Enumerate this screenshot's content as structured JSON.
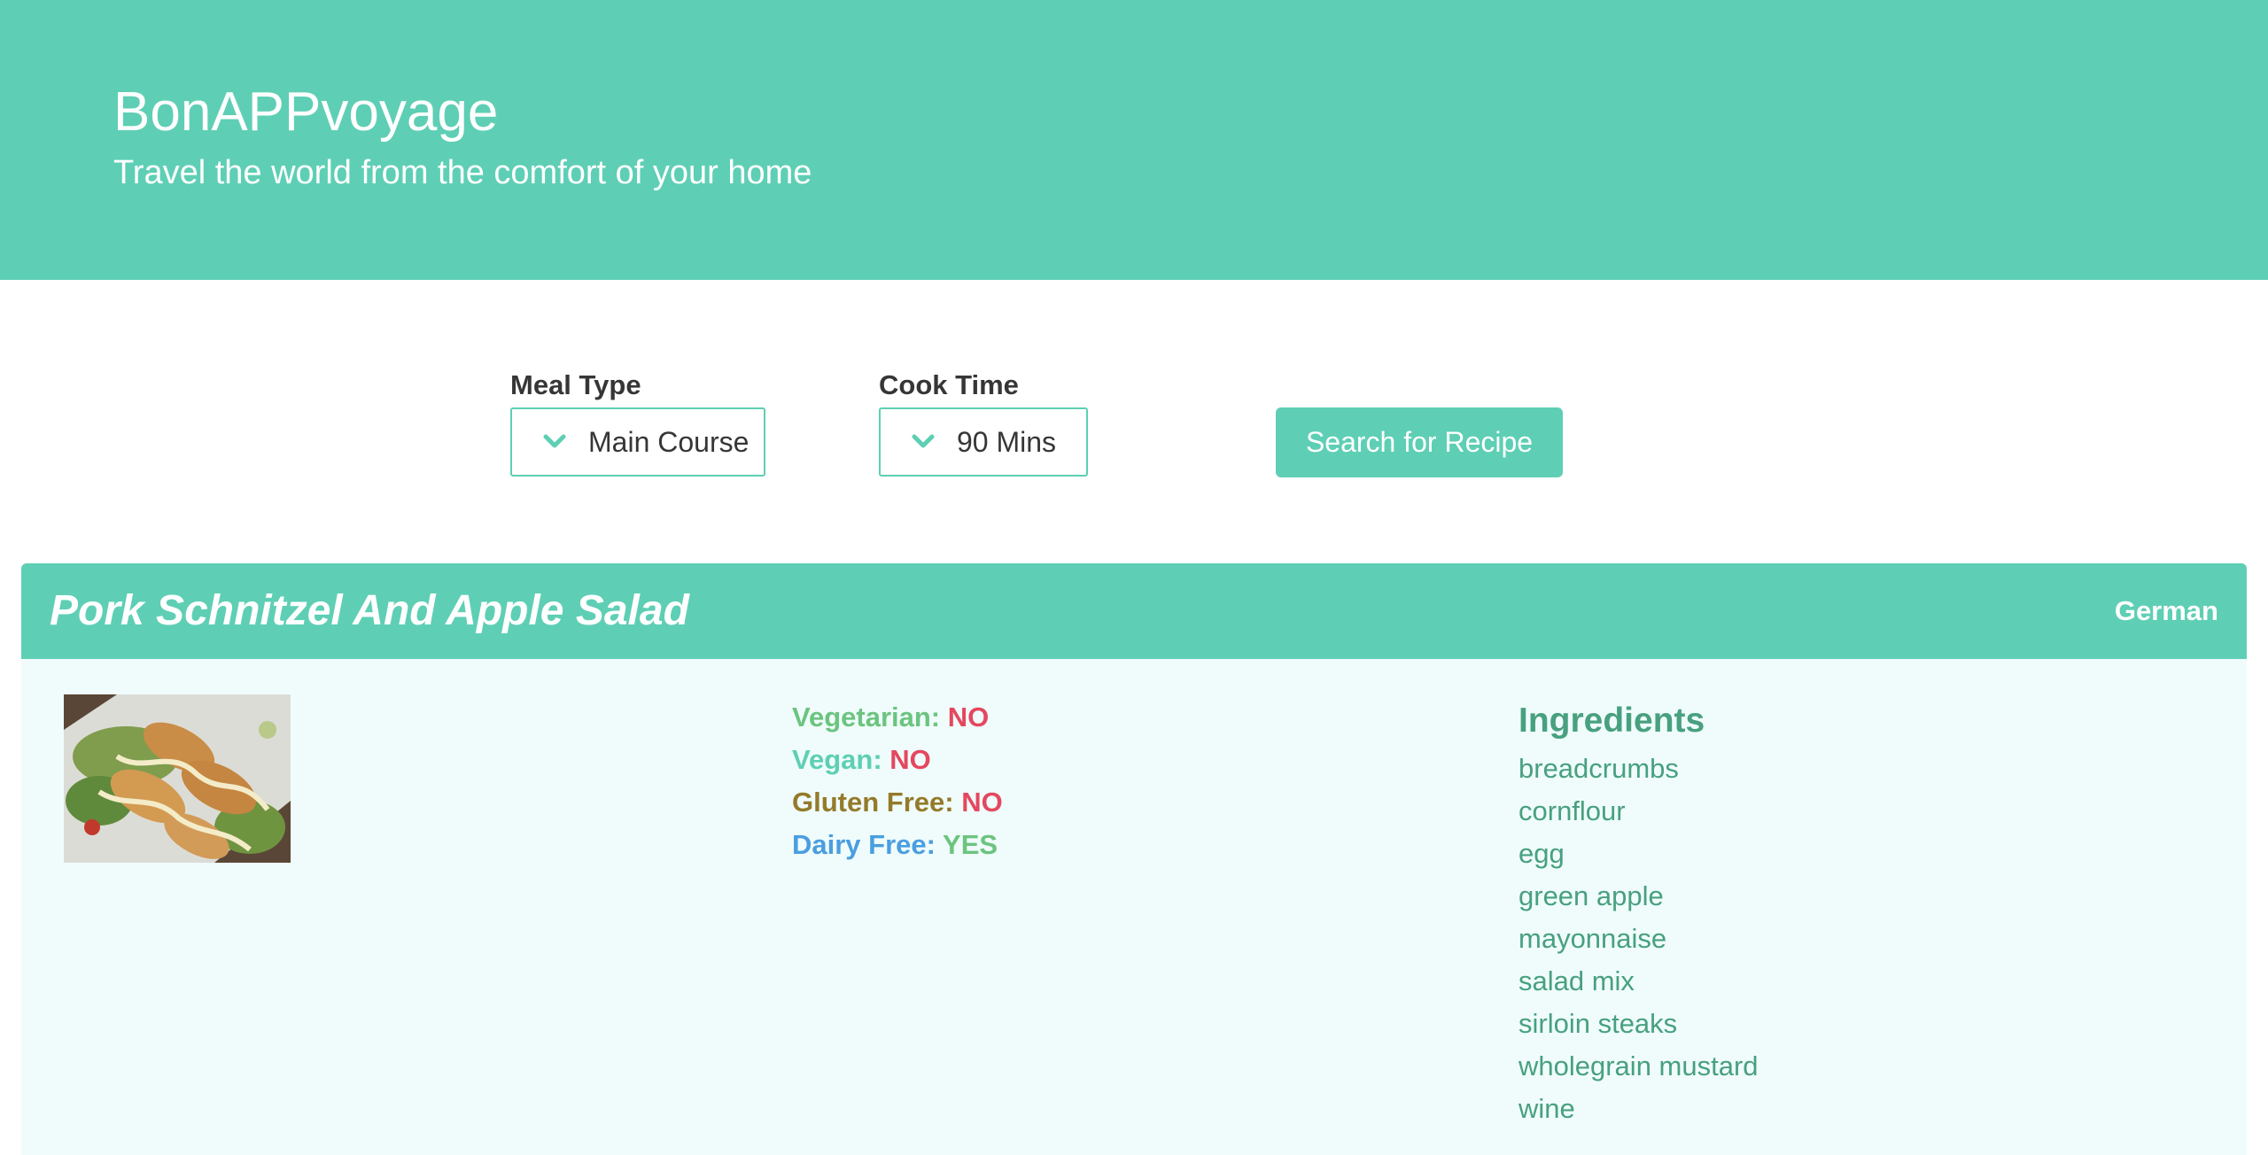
{
  "hero": {
    "title": "BonAPPvoyage",
    "subtitle": "Travel the world from the comfort of your home",
    "background": "#5ecfb4"
  },
  "search": {
    "meal_type_label": "Meal Type",
    "meal_type_value": "Main Course",
    "cook_time_label": "Cook Time",
    "cook_time_value": "90 Mins",
    "button_label": "Search for Recipe",
    "icon": "chevron-down-icon"
  },
  "recipe": {
    "title": "Pork Schnitzel And Apple Salad",
    "cuisine": "German",
    "image_icon": "food-photo",
    "diets": [
      {
        "label": "Vegetarian:",
        "value": "NO",
        "label_color": "#6cc47f",
        "value_color": "#e4485f"
      },
      {
        "label": "Vegan:",
        "value": "NO",
        "label_color": "#5ecfb4",
        "value_color": "#e4485f"
      },
      {
        "label": "Gluten Free:",
        "value": "NO",
        "label_color": "#947a2a",
        "value_color": "#e4485f"
      },
      {
        "label": "Dairy Free:",
        "value": "YES",
        "label_color": "#4a9ee0",
        "value_color": "#6cc47f"
      }
    ],
    "ingredients_title": "Ingredients",
    "ingredients": [
      "breadcrumbs",
      "cornflour",
      "egg",
      "green apple",
      "mayonnaise",
      "salad mix",
      "sirloin steaks",
      "wholegrain mustard",
      "wine"
    ]
  }
}
